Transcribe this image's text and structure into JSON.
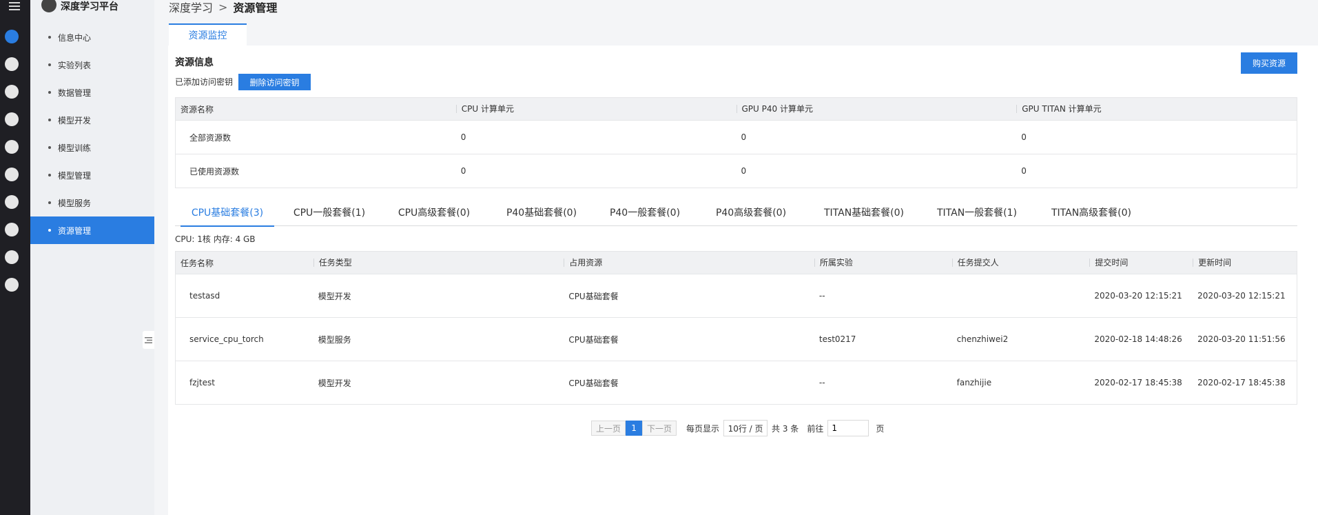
{
  "rail": {
    "icons": [
      "menu-icon",
      "brain-icon",
      "list-icon",
      "data-icon",
      "model-dev-icon",
      "train-icon",
      "model-manage-icon",
      "model-service-icon",
      "cloud-icon",
      "mail-icon",
      "id-card-icon"
    ]
  },
  "sidebar": {
    "brand": "深度学习平台",
    "items": [
      {
        "label": "信息中心"
      },
      {
        "label": "实验列表"
      },
      {
        "label": "数据管理"
      },
      {
        "label": "模型开发"
      },
      {
        "label": "模型训练"
      },
      {
        "label": "模型管理"
      },
      {
        "label": "模型服务"
      },
      {
        "label": "资源管理"
      }
    ]
  },
  "breadcrumb": {
    "parent": "深度学习",
    "separator": ">",
    "current": "资源管理"
  },
  "tab": {
    "label": "资源监控"
  },
  "resource": {
    "title": "资源信息",
    "buy_label": "购买资源",
    "key_status": "已添加访问密钥",
    "delete_key_label": "删除访问密钥",
    "headers": [
      "资源名称",
      "CPU 计算单元",
      "GPU P40 计算单元",
      "GPU TITAN 计算单元"
    ],
    "rows": [
      [
        "全部资源数",
        "0",
        "0",
        "0"
      ],
      [
        "已使用资源数",
        "0",
        "0",
        "0"
      ]
    ]
  },
  "package_tabs": [
    "CPU基础套餐(3)",
    "CPU一般套餐(1)",
    "CPU高级套餐(0)",
    "P40基础套餐(0)",
    "P40一般套餐(0)",
    "P40高级套餐(0)",
    "TITAN基础套餐(0)",
    "TITAN一般套餐(1)",
    "TITAN高级套餐(0)"
  ],
  "spec": "CPU: 1核 内存: 4 GB",
  "tasks": {
    "headers": [
      "任务名称",
      "任务类型",
      "占用资源",
      "所属实验",
      "任务提交人",
      "提交时间",
      "更新时间"
    ],
    "rows": [
      [
        "testasd",
        "模型开发",
        "CPU基础套餐",
        "--",
        "",
        "2020-03-20 12:15:21",
        "2020-03-20 12:15:21"
      ],
      [
        "service_cpu_torch",
        "模型服务",
        "CPU基础套餐",
        "test0217",
        "chenzhiwei2",
        "2020-02-18 14:48:26",
        "2020-03-20 11:51:56"
      ],
      [
        "fzjtest",
        "模型开发",
        "CPU基础套餐",
        "--",
        "fanzhijie",
        "2020-02-17 18:45:38",
        "2020-02-17 18:45:38"
      ]
    ]
  },
  "pagination": {
    "prev": "上一页",
    "current_page": "1",
    "next": "下一页",
    "per_page_label": "每页显示",
    "per_page_value": "10行 / 页",
    "total": "共 3 条",
    "goto_label": "前往",
    "goto_value": "1",
    "page_suffix": "页"
  },
  "colors": {
    "accent": "#2a7de1",
    "rail": "#1f1f24",
    "sidebar": "#eef0f3"
  }
}
